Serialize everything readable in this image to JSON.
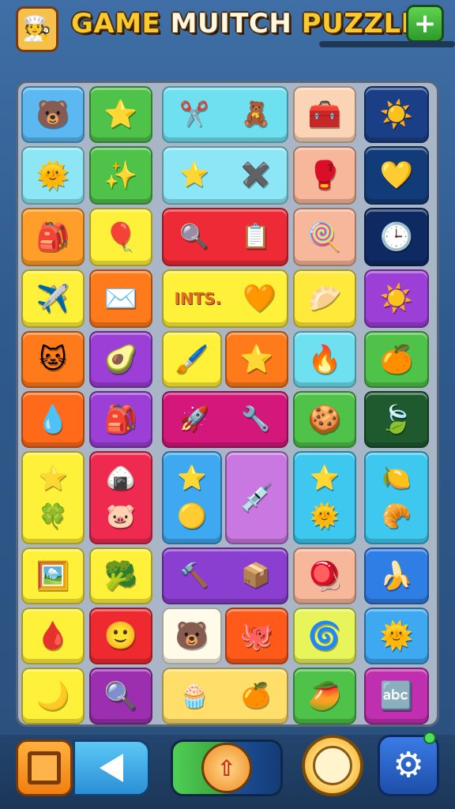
{
  "header": {
    "title_word_1": "GAME",
    "title_word_2": "MUITCH",
    "title_word_3": "PUZZLE",
    "plus_label": "+",
    "chef_icon": "🧑‍🍳"
  },
  "board": {
    "tiles": [
      {
        "id": "r1c1",
        "color": "#5bb8f0",
        "icons": [
          "🐻"
        ]
      },
      {
        "id": "r1c2",
        "color": "#4fc24a",
        "icons": [
          "⭐"
        ]
      },
      {
        "id": "r1c3",
        "color": "#6fe0f0",
        "icons": [
          "✂️",
          "🧸"
        ]
      },
      {
        "id": "r1c5",
        "color": "#fbd3b5",
        "icons": [
          "🧰"
        ]
      },
      {
        "id": "r1c6",
        "color": "#1b3f87",
        "icons": [
          "☀️"
        ]
      },
      {
        "id": "r2c1",
        "color": "#8de6f5",
        "icons": [
          "🌞"
        ]
      },
      {
        "id": "r2c2",
        "color": "#4fc24a",
        "icons": [
          "✨"
        ]
      },
      {
        "id": "r2c3",
        "color": "#8de6f5",
        "icons": [
          "⭐",
          "✖️"
        ]
      },
      {
        "id": "r2c5",
        "color": "#f7b79a",
        "icons": [
          "🥊"
        ]
      },
      {
        "id": "r2c6",
        "color": "#123b7a",
        "icons": [
          "💛"
        ]
      },
      {
        "id": "r3c1",
        "color": "#ff9f2a",
        "icons": [
          "🎒"
        ]
      },
      {
        "id": "r3c2",
        "color": "#fff03a",
        "icons": [
          "🎈"
        ]
      },
      {
        "id": "r3c3",
        "color": "#ee2a36",
        "icons": [
          "🔍",
          "📋"
        ]
      },
      {
        "id": "r3c5",
        "color": "#f7b79a",
        "icons": [
          "🍭"
        ]
      },
      {
        "id": "r3c6",
        "color": "#0f2a63",
        "icons": [
          "🕒"
        ]
      },
      {
        "id": "r4c1",
        "color": "#fff03a",
        "icons": [
          "✈️"
        ]
      },
      {
        "id": "r4c2",
        "color": "#ff7a1a",
        "icons": [
          "✉️"
        ]
      },
      {
        "id": "r4c3",
        "color": "#fff03a",
        "text": "INTS.",
        "icons": [
          "🧡"
        ]
      },
      {
        "id": "r4c5",
        "color": "#ffe93a",
        "icons": [
          "🥟"
        ]
      },
      {
        "id": "r4c6",
        "color": "#9b3fd6",
        "icons": [
          "☀️"
        ]
      },
      {
        "id": "r5c1",
        "color": "#ff7a1a",
        "icons": [
          "🐱"
        ]
      },
      {
        "id": "r5c2",
        "color": "#9b3fd6",
        "icons": [
          "🥑"
        ]
      },
      {
        "id": "r5c3",
        "color": "#fff03a",
        "icons": [
          "🖌️"
        ]
      },
      {
        "id": "r5c4",
        "color": "#ff7a1a",
        "icons": [
          "⭐"
        ]
      },
      {
        "id": "r5c5",
        "color": "#6fe0f0",
        "icons": [
          "🔥"
        ]
      },
      {
        "id": "r5c6",
        "color": "#4fc24a",
        "icons": [
          "🍊"
        ]
      },
      {
        "id": "r6c1",
        "color": "#ff6a1a",
        "icons": [
          "💧"
        ]
      },
      {
        "id": "r6c2",
        "color": "#9b3fd6",
        "icons": [
          "🎒"
        ]
      },
      {
        "id": "r6c3",
        "color": "#d4177a",
        "icons": [
          "🚀",
          "🔧"
        ]
      },
      {
        "id": "r6c5",
        "color": "#4fc24a",
        "icons": [
          "🍪"
        ]
      },
      {
        "id": "r6c6",
        "color": "#1f5a2f",
        "icons": [
          "🍃"
        ]
      },
      {
        "id": "r7c1",
        "color": "#fff03a",
        "icons": [
          "⭐",
          "🍀"
        ]
      },
      {
        "id": "r7c2",
        "color": "#ee2a50",
        "icons": [
          "🍙",
          "🐷"
        ]
      },
      {
        "id": "r7c3",
        "color": "#3ea8f0",
        "icons": [
          "⭐",
          "🟡"
        ]
      },
      {
        "id": "r7c4",
        "color": "#c878e0",
        "icons": [
          "💉"
        ]
      },
      {
        "id": "r7c5",
        "color": "#3ec8f0",
        "icons": [
          "⭐",
          "🌞"
        ]
      },
      {
        "id": "r7c6",
        "color": "#3ec8f0",
        "icons": [
          "🍋",
          "🥐"
        ]
      },
      {
        "id": "r8c1",
        "color": "#fff03a",
        "icons": [
          "🖼️"
        ]
      },
      {
        "id": "r8c2",
        "color": "#fff03a",
        "icons": [
          "🥦"
        ]
      },
      {
        "id": "r8c3",
        "color": "#8a3fd0",
        "icons": [
          "🔨",
          "📦"
        ]
      },
      {
        "id": "r8c5",
        "color": "#f7b79a",
        "icons": [
          "🪀"
        ]
      },
      {
        "id": "r8c6",
        "color": "#2f7ee6",
        "icons": [
          "🍌"
        ]
      },
      {
        "id": "r9c1",
        "color": "#fff03a",
        "icons": [
          "🩸"
        ]
      },
      {
        "id": "r9c2",
        "color": "#ee2a30",
        "icons": [
          "🙂"
        ]
      },
      {
        "id": "r9c3",
        "color": "#fffbe8",
        "icons": [
          "🐻"
        ]
      },
      {
        "id": "r9c4",
        "color": "#ff5a1a",
        "icons": [
          "🐙"
        ]
      },
      {
        "id": "r9c5",
        "color": "#e8f55a",
        "icons": [
          "🌀"
        ]
      },
      {
        "id": "r9c6",
        "color": "#3ea8f0",
        "icons": [
          "🌞"
        ]
      },
      {
        "id": "r10c1",
        "color": "#fff03a",
        "icons": [
          "🌙"
        ]
      },
      {
        "id": "r10c2",
        "color": "#9b2fb0",
        "icons": [
          "🔍"
        ]
      },
      {
        "id": "r10c3",
        "color": "#ffdf6a",
        "icons": [
          "🧁",
          "🍊"
        ]
      },
      {
        "id": "r10c5",
        "color": "#4fc24a",
        "icons": [
          "🥭"
        ]
      },
      {
        "id": "r10c6",
        "color": "#c02fb0",
        "icons": [
          "🔤"
        ]
      }
    ]
  },
  "bottom_bar": {
    "square_icon": "square-icon",
    "back_icon": "back-icon",
    "compass_glyph": "⇧",
    "clock_icon": "clock-icon",
    "gear_glyph": "⚙"
  }
}
